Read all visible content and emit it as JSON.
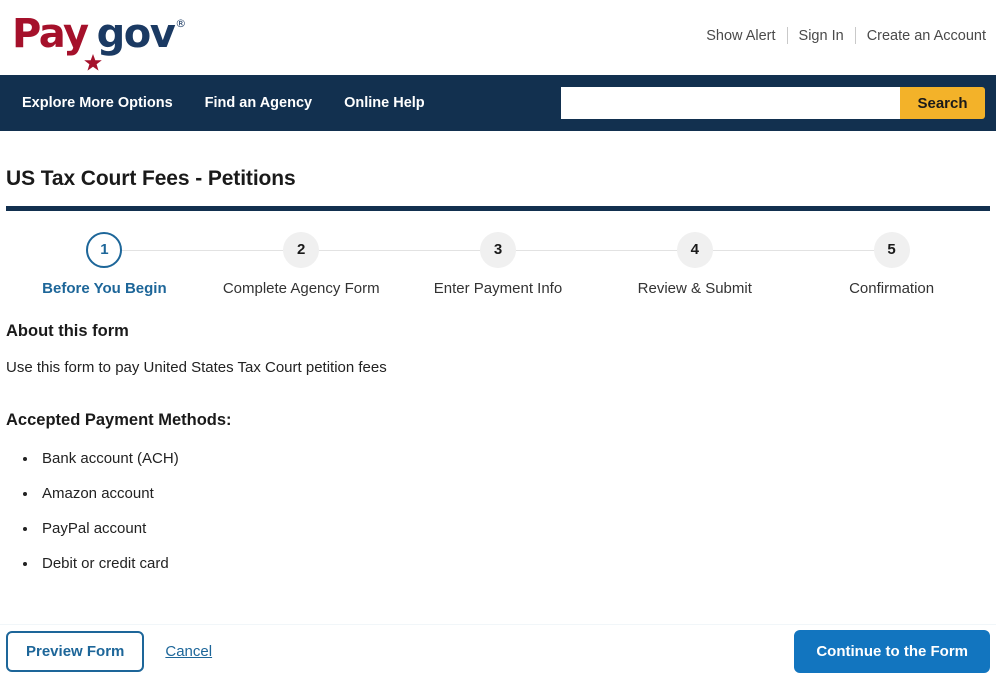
{
  "brand": {
    "logo_pay": "Pay",
    "logo_star": "star-icon",
    "logo_gov": "gov",
    "logo_registered": "®",
    "colors": {
      "logo_pay": "#a5112b",
      "logo_gov": "#1b3a63",
      "navbar": "#12304f",
      "search_button": "#f3b229",
      "accent_blue": "#1d6699",
      "primary_button": "#1275bf",
      "step_inactive": "#f0f0f0"
    }
  },
  "utility": {
    "links": [
      {
        "label": "Show Alert"
      },
      {
        "label": "Sign In"
      },
      {
        "label": "Create an Account"
      }
    ]
  },
  "nav": {
    "links": [
      {
        "label": "Explore More Options"
      },
      {
        "label": "Find an Agency"
      },
      {
        "label": "Online Help"
      }
    ]
  },
  "search": {
    "value": "",
    "placeholder": "",
    "button_label": "Search"
  },
  "header": {
    "title": "US Tax Court Fees - Petitions"
  },
  "stepper": {
    "current_step": 1,
    "steps": [
      {
        "number": "1",
        "label": "Before You Begin",
        "state": "active"
      },
      {
        "number": "2",
        "label": "Complete Agency Form",
        "state": "inactive"
      },
      {
        "number": "3",
        "label": "Enter Payment Info",
        "state": "inactive"
      },
      {
        "number": "4",
        "label": "Review & Submit",
        "state": "inactive"
      },
      {
        "number": "5",
        "label": "Confirmation",
        "state": "inactive"
      }
    ]
  },
  "about": {
    "heading": "About this form",
    "text": "Use this form to pay United States Tax Court petition fees"
  },
  "payment_methods": {
    "heading": "Accepted Payment Methods:",
    "items": [
      {
        "label": "Bank account (ACH)"
      },
      {
        "label": "Amazon account"
      },
      {
        "label": "PayPal account"
      },
      {
        "label": "Debit or credit card"
      }
    ]
  },
  "actions": {
    "preview_label": "Preview Form",
    "cancel_label": "Cancel",
    "continue_label": "Continue to the Form"
  }
}
